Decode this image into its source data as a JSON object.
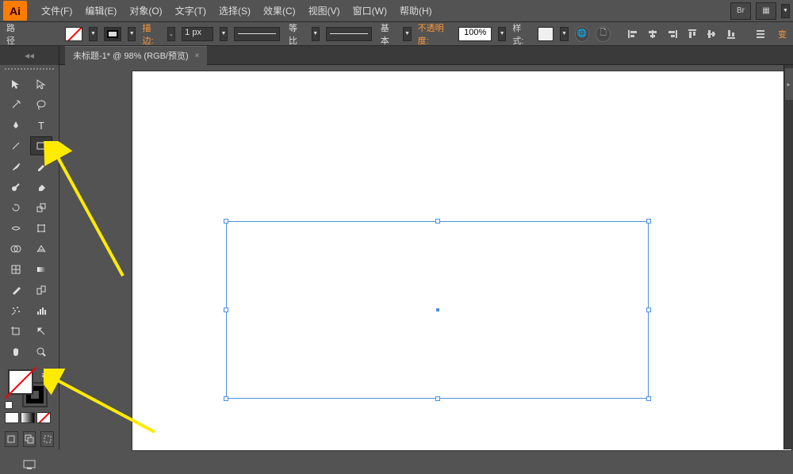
{
  "app": {
    "logo": "Ai"
  },
  "menu": {
    "items": [
      "文件(F)",
      "编辑(E)",
      "对象(O)",
      "文字(T)",
      "选择(S)",
      "效果(C)",
      "视图(V)",
      "窗口(W)",
      "帮助(H)"
    ],
    "right": {
      "br": "Br",
      "layout": "▦"
    }
  },
  "options": {
    "path_label": "路径",
    "stroke_label": "描边:",
    "stroke_width": "1 px",
    "profile_label": "等比",
    "brush_label": "基本",
    "opacity_label": "不透明度:",
    "opacity_value": "100%",
    "style_label": "样式:",
    "transform_label": "变",
    "globe": "🌐",
    "doc": "🗋"
  },
  "tab": {
    "title": "未标题-1* @ 98% (RGB/预览)",
    "close": "×"
  },
  "tools": {
    "row1": [
      "select",
      "direct-select"
    ],
    "row2": [
      "magic-wand",
      "lasso"
    ],
    "row3": [
      "pen",
      "type"
    ],
    "row4": [
      "line",
      "rectangle"
    ],
    "row5": [
      "paintbrush",
      "pencil"
    ],
    "row6": [
      "blob-brush",
      "eraser"
    ],
    "row7": [
      "rotate",
      "scale"
    ],
    "row8": [
      "width",
      "free-transform"
    ],
    "row9": [
      "shape-builder",
      "perspective"
    ],
    "row10": [
      "mesh",
      "gradient"
    ],
    "row11": [
      "eyedropper",
      "blend"
    ],
    "row12": [
      "symbol-sprayer",
      "graph"
    ],
    "row13": [
      "artboard",
      "slice"
    ],
    "row14": [
      "hand",
      "zoom"
    ]
  }
}
